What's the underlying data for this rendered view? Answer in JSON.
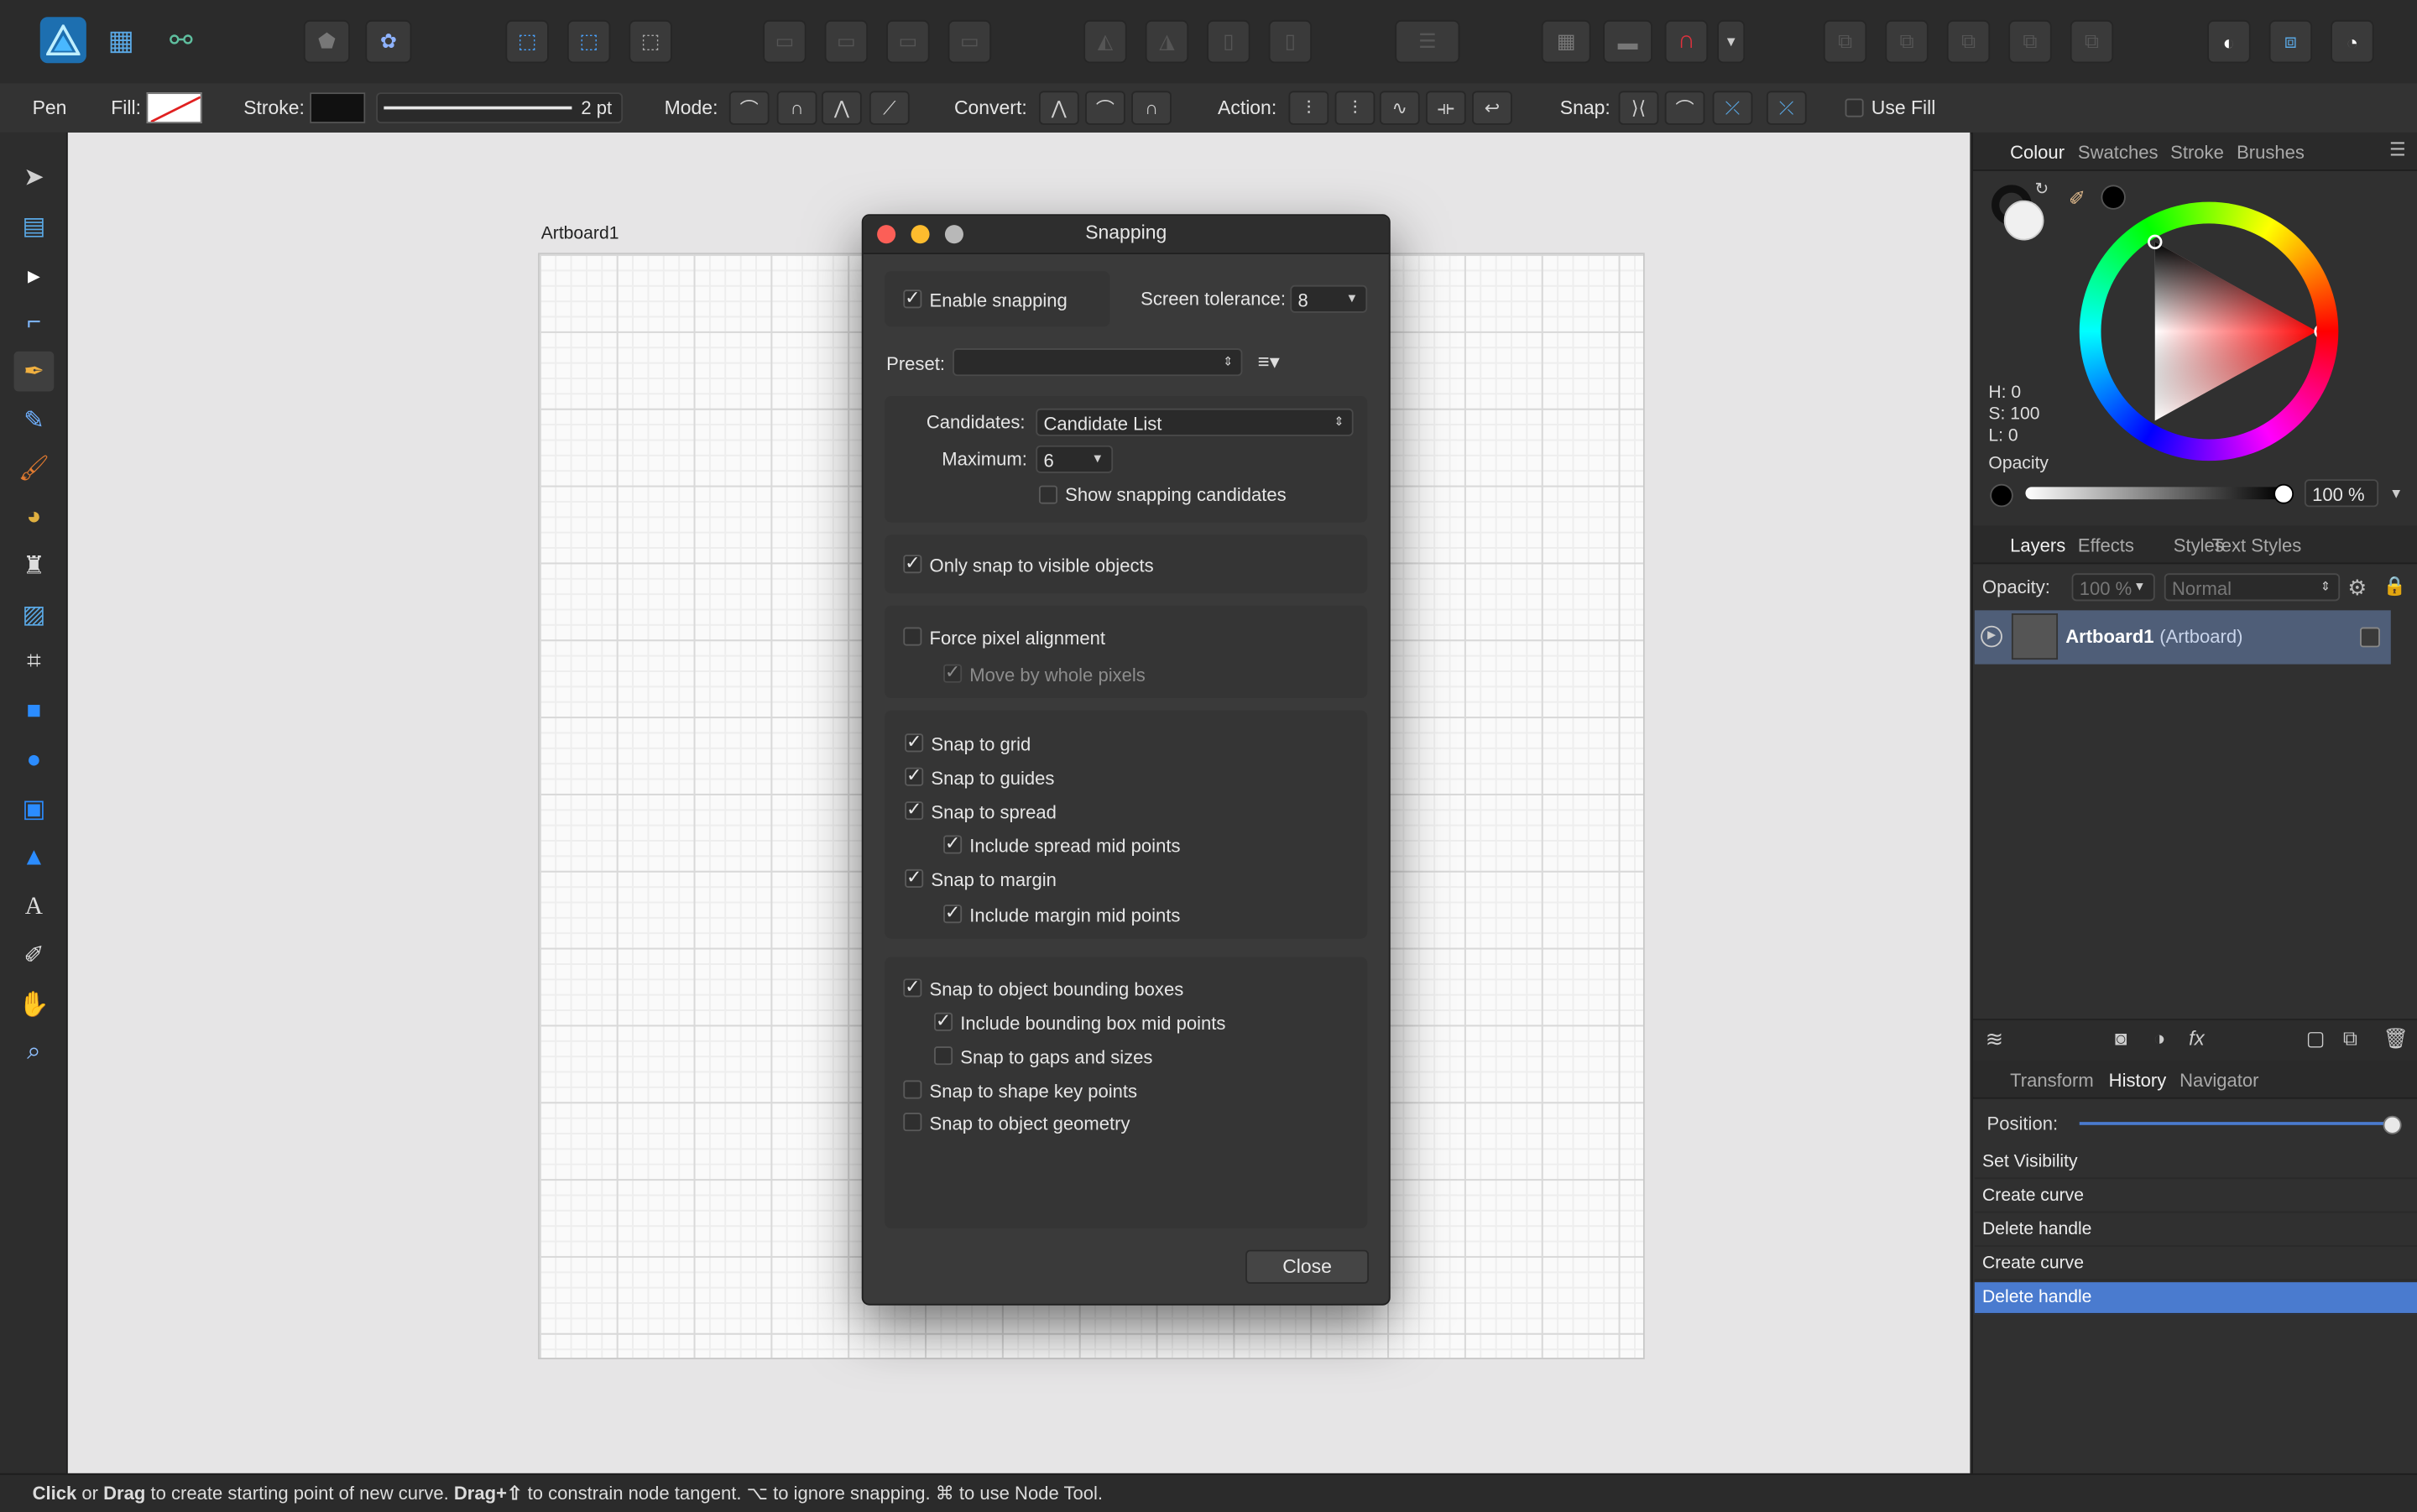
{
  "context_bar": {
    "tool_name": "Pen",
    "fill_label": "Fill:",
    "stroke_label": "Stroke:",
    "stroke_width": "2 pt",
    "mode_label": "Mode:",
    "convert_label": "Convert:",
    "action_label": "Action:",
    "snap_label": "Snap:",
    "use_fill_label": "Use Fill"
  },
  "canvas": {
    "artboard_title": "Artboard1"
  },
  "dialog": {
    "title": "Snapping",
    "enable_snapping": "Enable snapping",
    "screen_tolerance_label": "Screen tolerance:",
    "screen_tolerance_value": "8",
    "preset_label": "Preset:",
    "preset_value": "",
    "candidates_label": "Candidates:",
    "candidates_value": "Candidate List",
    "maximum_label": "Maximum:",
    "maximum_value": "6",
    "show_candidates": "Show snapping candidates",
    "only_visible": "Only snap to visible objects",
    "force_pixel": "Force pixel alignment",
    "move_whole_pixels": "Move by whole pixels",
    "snap_grid": "Snap to grid",
    "snap_guides": "Snap to guides",
    "snap_spread": "Snap to spread",
    "spread_mid": "Include spread mid points",
    "snap_margin": "Snap to margin",
    "margin_mid": "Include margin mid points",
    "snap_bbox": "Snap to object bounding boxes",
    "bbox_mid": "Include bounding box mid points",
    "snap_gaps": "Snap to gaps and sizes",
    "snap_shape_key": "Snap to shape key points",
    "snap_geometry": "Snap to object geometry",
    "close_label": "Close"
  },
  "colour_panel": {
    "tabs": [
      "Colour",
      "Swatches",
      "Stroke",
      "Brushes"
    ],
    "h": "H: 0",
    "s": "S: 100",
    "l": "L: 0",
    "opacity_label": "Opacity",
    "opacity_value": "100 %"
  },
  "layers_panel": {
    "tabs": [
      "Layers",
      "Effects",
      "Styles",
      "Text Styles"
    ],
    "opacity_label": "Opacity:",
    "opacity_value": "100 %",
    "blend_mode": "Normal",
    "layer_name": "Artboard1",
    "layer_type": "(Artboard)"
  },
  "history_panel": {
    "tabs": [
      "Transform",
      "History",
      "Navigator"
    ],
    "position_label": "Position:",
    "items": [
      "Set Visibility",
      "Create curve",
      "Delete handle",
      "Create curve",
      "Delete handle"
    ]
  },
  "status": {
    "w1": "Click",
    "t1": " or ",
    "w2": "Drag",
    "t2": " to create starting point of new curve. ",
    "w3": "Drag+⇧",
    "t3": " to constrain node tangent. ⌥ to ignore snapping. ⌘ to use Node Tool."
  },
  "colors": {
    "accent": "#4a7bcf",
    "snap_magnet": "#e0313d",
    "fill_none": "#e02020"
  }
}
